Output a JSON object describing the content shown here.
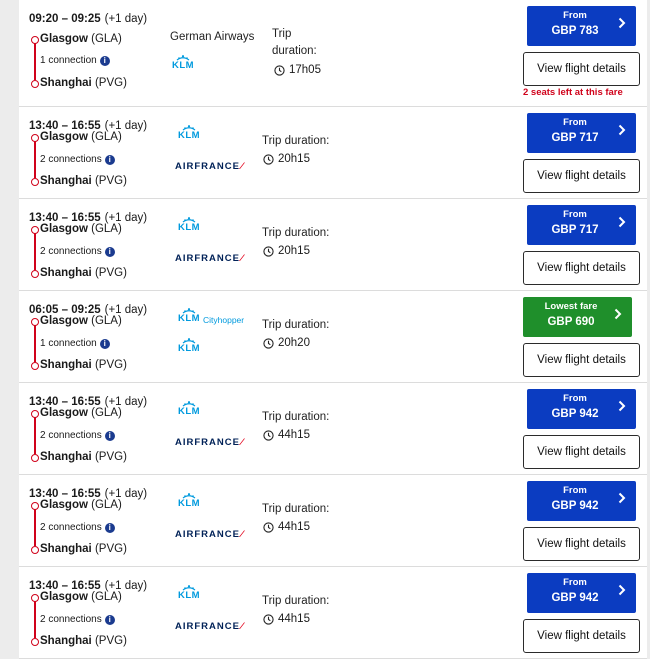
{
  "flights": [
    {
      "times": "09:20 – 09:25",
      "days": "(+1 day)",
      "origin_city": "Glasgow",
      "origin_code": "(GLA)",
      "connections": "1 connection",
      "dest_city": "Shanghai",
      "dest_code": "(PVG)",
      "operator_text": "German Airways",
      "logos": [
        "klm"
      ],
      "duration_label": "Trip duration:",
      "duration": "17h05",
      "fare_label": "From",
      "fare": "GBP 783",
      "highlight": false,
      "details_label": "View flight details",
      "seats_note": "2 seats left at this fare"
    },
    {
      "times": "13:40 – 16:55",
      "days": "(+1 day)",
      "origin_city": "Glasgow",
      "origin_code": "(GLA)",
      "connections": "2 connections",
      "dest_city": "Shanghai",
      "dest_code": "(PVG)",
      "logos": [
        "klm",
        "airfrance"
      ],
      "duration_label": "Trip duration:",
      "duration": "20h15",
      "fare_label": "From",
      "fare": "GBP 717",
      "highlight": false,
      "details_label": "View flight details"
    },
    {
      "times": "13:40 – 16:55",
      "days": "(+1 day)",
      "origin_city": "Glasgow",
      "origin_code": "(GLA)",
      "connections": "2 connections",
      "dest_city": "Shanghai",
      "dest_code": "(PVG)",
      "logos": [
        "klm",
        "airfrance"
      ],
      "duration_label": "Trip duration:",
      "duration": "20h15",
      "fare_label": "From",
      "fare": "GBP 717",
      "highlight": false,
      "details_label": "View flight details"
    },
    {
      "times": "06:05 – 09:25",
      "days": "(+1 day)",
      "origin_city": "Glasgow",
      "origin_code": "(GLA)",
      "connections": "1 connection",
      "dest_city": "Shanghai",
      "dest_code": "(PVG)",
      "logos": [
        "klm-cityhopper",
        "klm"
      ],
      "cityhopper_text": "Cityhopper",
      "duration_label": "Trip duration:",
      "duration": "20h20",
      "fare_label": "Lowest fare",
      "fare": "GBP 690",
      "highlight": true,
      "details_label": "View flight details"
    },
    {
      "times": "13:40 – 16:55",
      "days": "(+1 day)",
      "origin_city": "Glasgow",
      "origin_code": "(GLA)",
      "connections": "2 connections",
      "dest_city": "Shanghai",
      "dest_code": "(PVG)",
      "logos": [
        "klm",
        "airfrance"
      ],
      "duration_label": "Trip duration:",
      "duration": "44h15",
      "fare_label": "From",
      "fare": "GBP 942",
      "highlight": false,
      "details_label": "View flight details"
    },
    {
      "times": "13:40 – 16:55",
      "days": "(+1 day)",
      "origin_city": "Glasgow",
      "origin_code": "(GLA)",
      "connections": "2 connections",
      "dest_city": "Shanghai",
      "dest_code": "(PVG)",
      "logos": [
        "klm",
        "airfrance"
      ],
      "duration_label": "Trip duration:",
      "duration": "44h15",
      "fare_label": "From",
      "fare": "GBP 942",
      "highlight": false,
      "details_label": "View flight details"
    },
    {
      "times": "13:40 – 16:55",
      "days": "(+1 day)",
      "origin_city": "Glasgow",
      "origin_code": "(GLA)",
      "connections": "2 connections",
      "dest_city": "Shanghai",
      "dest_code": "(PVG)",
      "logos": [
        "klm",
        "airfrance"
      ],
      "duration_label": "Trip duration:",
      "duration": "44h15",
      "fare_label": "From",
      "fare": "GBP 942",
      "highlight": false,
      "details_label": "View flight details"
    }
  ],
  "logo_text": {
    "klm": "KLM",
    "airfrance": "AIRFRANCE"
  },
  "colors": {
    "brand_blue": "#0b3cc1",
    "lowest_fare_green": "#1f8f2b",
    "route_red": "#d0021b",
    "klm_blue": "#009ade",
    "airfrance_navy": "#002157"
  },
  "icons": {
    "info": "info-icon",
    "clock": "clock-icon",
    "chevron": "chevron-right-icon",
    "crown": "klm-crown-icon"
  }
}
